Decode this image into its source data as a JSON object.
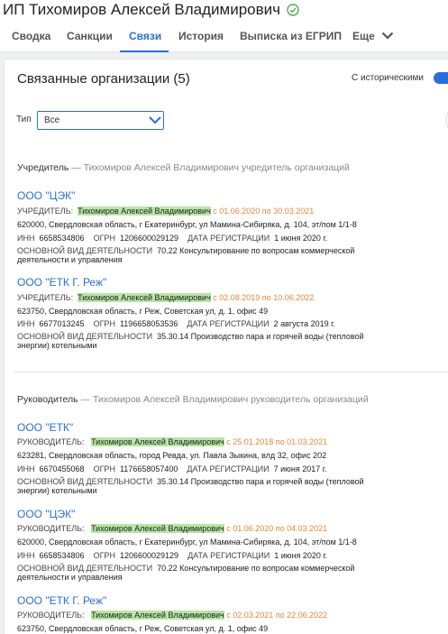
{
  "header": {
    "title": "ИП Тихомиров Алексей Владимирович",
    "verified_icon": "check-circle-icon",
    "tabs": [
      {
        "label": "Сводка"
      },
      {
        "label": "Санкции"
      },
      {
        "label": "Связи",
        "active": true
      },
      {
        "label": "История"
      },
      {
        "label": "Выписка из ЕГРИП"
      },
      {
        "label": "Еще"
      }
    ]
  },
  "colors": {
    "accent": "#2a6ed9",
    "highlight": "#b7e6a5",
    "period": "#e0893a",
    "verified": "#4caf50"
  },
  "panel": {
    "title": "Связанные организации (5)",
    "historical_label": "С историческими",
    "historical_on": true,
    "type_label": "Тип",
    "type_value": "Все"
  },
  "sections": [
    {
      "heading": "Учредитель",
      "subheading": " — Тихомиров Алексей Владимирович учредитель организаций",
      "orgs": [
        {
          "name": "ООО \"ЦЭК\"",
          "role_label": "УЧРЕДИТЕЛЬ:",
          "person": "Тихомиров Алексей Владимирович",
          "period": " с 01.06.2020 по 30.03.2021",
          "address": "620000, Свердловская область, г Екатеринбург, ул Мамина-Сибиряка, д. 104, эт/пом 1/1-8",
          "inn_label": "ИНН",
          "inn": "6658534806",
          "ogrn_label": "ОГРН",
          "ogrn": "1206600029129",
          "reg_label": "ДАТА РЕГИСТРАЦИИ",
          "reg_date": "1 июня 2020 г.",
          "activity_label": "ОСНОВНОЙ ВИД ДЕЯТЕЛЬНОСТИ",
          "activity_1": "70.22 Консультирование по вопросам коммерческой",
          "activity_2": "деятельности и управления"
        },
        {
          "name": "ООО \"ЕТК Г. Реж\"",
          "role_label": "УЧРЕДИТЕЛЬ:",
          "person": "Тихомиров Алексей Владимирович",
          "period": " с 02.08.2019 по 10.06.2022",
          "address": "623750, Свердловская область, г Реж, Советская ул, д. 1, офис 49",
          "inn_label": "ИНН",
          "inn": "6677013245",
          "ogrn_label": "ОГРН",
          "ogrn": "1196658053536",
          "reg_label": "ДАТА РЕГИСТРАЦИИ",
          "reg_date": "2 августа 2019 г.",
          "activity_label": "ОСНОВНОЙ ВИД ДЕЯТЕЛЬНОСТИ",
          "activity_1": "35.30.14 Производство пара и горячей воды (тепловой",
          "activity_2": "энергии) котельными"
        }
      ]
    },
    {
      "heading": "Руководитель",
      "subheading": " — Тихомиров Алексей Владимирович руководитель организаций",
      "orgs": [
        {
          "name": "ООО \"ЕТК\"",
          "role_label": "РУКОВОДИТЕЛЬ:",
          "person": "Тихомиров Алексей Владимирович",
          "period": " с 25.01.2018 по 01.03.2021",
          "address": "623281, Свердловская область, город Ревда, ул. Павла Зыкина, влд 32, офис 202",
          "inn_label": "ИНН",
          "inn": "6670455068",
          "ogrn_label": "ОГРН",
          "ogrn": "1176658057400",
          "reg_label": "ДАТА РЕГИСТРАЦИИ",
          "reg_date": "7 июня 2017 г.",
          "activity_label": "ОСНОВНОЙ ВИД ДЕЯТЕЛЬНОСТИ",
          "activity_1": "35.30.14 Производство пара и горячей воды (тепловой",
          "activity_2": "энергии) котельными"
        },
        {
          "name": "ООО \"ЦЭК\"",
          "role_label": "РУКОВОДИТЕЛЬ:",
          "person": "Тихомиров Алексей Владимирович",
          "period": " с 01.06.2020 по 04.03.2021",
          "address": "620000, Свердловская область, г Екатеринбург, ул Мамина-Сибиряка, д. 104, эт/пом 1/1-8",
          "inn_label": "ИНН",
          "inn": "6658534806",
          "ogrn_label": "ОГРН",
          "ogrn": "1206600029129",
          "reg_label": "ДАТА РЕГИСТРАЦИИ",
          "reg_date": "1 июня 2020 г.",
          "activity_label": "ОСНОВНОЙ ВИД ДЕЯТЕЛЬНОСТИ",
          "activity_1": "70.22 Консультирование по вопросам коммерческой",
          "activity_2": "деятельности и управления"
        },
        {
          "name": "ООО \"ЕТК Г. Реж\"",
          "role_label": "РУКОВОДИТЕЛЬ:",
          "person": "Тихомиров Алексей Владимирович",
          "period": " с 02.03.2021 по 22.06.2022",
          "address": "623750, Свердловская область, г Реж, Советская ул, д. 1, офис 49"
        }
      ]
    }
  ]
}
